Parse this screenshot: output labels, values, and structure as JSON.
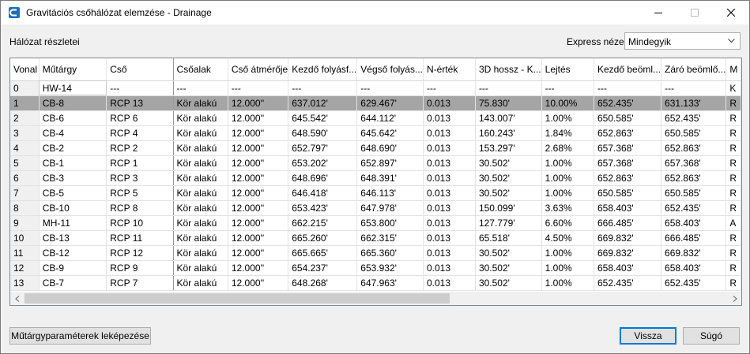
{
  "window": {
    "title": "Gravitációs csőhálózat elemzése - Drainage"
  },
  "labels": {
    "network_details": "Hálózat részletei",
    "express_view": "Express nézet"
  },
  "express_select": {
    "value": "Mindegyik"
  },
  "table": {
    "headers": [
      "Vonal",
      "Műtárgy",
      "Cső",
      "Csőalak",
      "Cső átmérője",
      "Kezdő folyásf...",
      "Végső  folyás...",
      "N-érték",
      "3D hossz - K...",
      "Lejtés",
      "Kezdő beöml...",
      "Záró beömlő...",
      "M"
    ],
    "rows": [
      [
        "0",
        "HW-14",
        "---",
        "---",
        "---",
        "---",
        "---",
        "---",
        "---",
        "---",
        "---",
        "---",
        "K"
      ],
      [
        "1",
        "CB-8",
        "RCP 13",
        "Kör alakú",
        "12.000''",
        "637.012'",
        "629.467'",
        "0.013",
        "75.830'",
        "10.00%",
        "652.435'",
        "631.133'",
        "R"
      ],
      [
        "2",
        "CB-6",
        "RCP 6",
        "Kör alakú",
        "12.000''",
        "645.542'",
        "644.112'",
        "0.013",
        "143.007'",
        "1.00%",
        "650.585'",
        "652.435'",
        "R"
      ],
      [
        "3",
        "CB-4",
        "RCP 4",
        "Kör alakú",
        "12.000''",
        "648.590'",
        "645.642'",
        "0.013",
        "160.243'",
        "1.84%",
        "652.863'",
        "650.585'",
        "R"
      ],
      [
        "4",
        "CB-2",
        "RCP 2",
        "Kör alakú",
        "12.000''",
        "652.797'",
        "648.690'",
        "0.013",
        "153.297'",
        "2.68%",
        "657.368'",
        "652.863'",
        "R"
      ],
      [
        "5",
        "CB-1",
        "RCP 1",
        "Kör alakú",
        "12.000''",
        "653.202'",
        "652.897'",
        "0.013",
        "30.502'",
        "1.00%",
        "657.368'",
        "657.368'",
        "R"
      ],
      [
        "6",
        "CB-3",
        "RCP 3",
        "Kör alakú",
        "12.000''",
        "648.696'",
        "648.391'",
        "0.013",
        "30.502'",
        "1.00%",
        "652.863'",
        "652.863'",
        "R"
      ],
      [
        "7",
        "CB-5",
        "RCP 5",
        "Kör alakú",
        "12.000''",
        "646.418'",
        "646.113'",
        "0.013",
        "30.502'",
        "1.00%",
        "650.585'",
        "650.585'",
        "R"
      ],
      [
        "8",
        "CB-10",
        "RCP 8",
        "Kör alakú",
        "12.000''",
        "653.423'",
        "647.978'",
        "0.013",
        "150.099'",
        "3.63%",
        "658.403'",
        "652.435'",
        "R"
      ],
      [
        "9",
        "MH-11",
        "RCP 10",
        "Kör alakú",
        "12.000''",
        "662.215'",
        "653.800'",
        "0.013",
        "127.779'",
        "6.60%",
        "666.485'",
        "658.403'",
        "A"
      ],
      [
        "10",
        "CB-13",
        "RCP 11",
        "Kör alakú",
        "12.000''",
        "665.260'",
        "662.315'",
        "0.013",
        "65.518'",
        "4.50%",
        "669.832'",
        "666.485'",
        "R"
      ],
      [
        "11",
        "CB-12",
        "RCP 12",
        "Kör alakú",
        "12.000''",
        "665.665'",
        "665.360'",
        "0.013",
        "30.502'",
        "1.00%",
        "669.832'",
        "669.832'",
        "R"
      ],
      [
        "12",
        "CB-9",
        "RCP 9",
        "Kör alakú",
        "12.000''",
        "654.237'",
        "653.932'",
        "0.013",
        "30.502'",
        "1.00%",
        "658.403'",
        "658.403'",
        "R"
      ],
      [
        "13",
        "CB-7",
        "RCP 7",
        "Kör alakú",
        "12.000''",
        "648.268'",
        "647.963'",
        "0.013",
        "30.502'",
        "1.00%",
        "652.435'",
        "652.435'",
        "R"
      ]
    ],
    "selected_row": 1
  },
  "buttons": {
    "map_params": "Műtárgyparaméterek leképezése",
    "back": "Vissza",
    "help": "Súgó"
  },
  "colors": {
    "accent": "#0078d7",
    "selected_row": "#a5a5a5"
  }
}
